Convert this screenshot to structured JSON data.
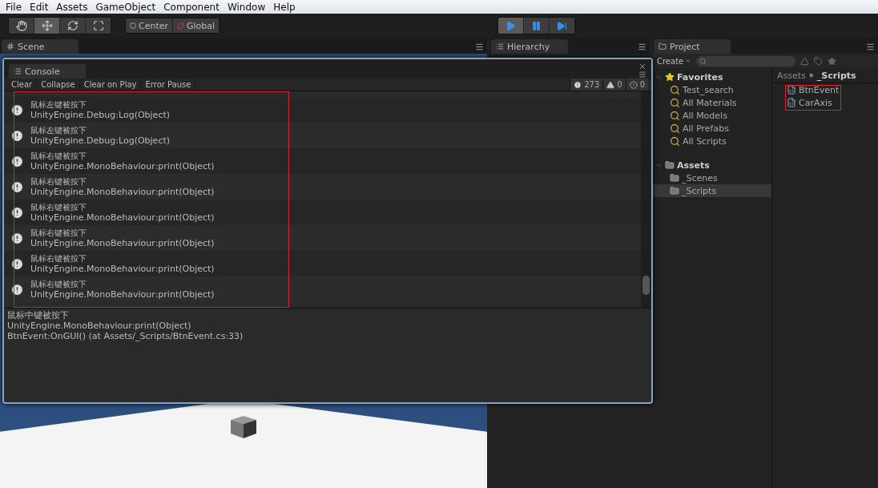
{
  "menu": [
    "File",
    "Edit",
    "Assets",
    "GameObject",
    "Component",
    "Window",
    "Help"
  ],
  "tools": [
    {
      "kind": "hand",
      "selected": false
    },
    {
      "kind": "move",
      "selected": true
    },
    {
      "kind": "rotate",
      "selected": false
    },
    {
      "kind": "scale",
      "selected": false
    }
  ],
  "pivot": [
    {
      "kind": "pivot",
      "label": "Center"
    },
    {
      "kind": "space",
      "label": "Global"
    }
  ],
  "playback": [
    {
      "kind": "play",
      "on": true
    },
    {
      "kind": "pause",
      "on": false
    },
    {
      "kind": "step",
      "on": false
    }
  ],
  "scene": {
    "tab": "Scene"
  },
  "hierarchy": {
    "tab": "Hierarchy"
  },
  "console": {
    "tab": "Console",
    "toolbar": [
      "Clear",
      "Collapse",
      "Clear on Play",
      "Error Pause"
    ],
    "counts": [
      {
        "kind": "log",
        "value": "273"
      },
      {
        "kind": "warning",
        "value": "0"
      },
      {
        "kind": "error",
        "value": "0"
      }
    ],
    "highlighted": true,
    "entries": [
      {
        "message": "鼠标左键被按下",
        "trace": "UnityEngine.Debug:Log(Object)"
      },
      {
        "message": "鼠标左键被按下",
        "trace": "UnityEngine.Debug:Log(Object)"
      },
      {
        "message": "鼠标右键被按下",
        "trace": "UnityEngine.MonoBehaviour:print(Object)"
      },
      {
        "message": "鼠标右键被按下",
        "trace": "UnityEngine.MonoBehaviour:print(Object)"
      },
      {
        "message": "鼠标右键被按下",
        "trace": "UnityEngine.MonoBehaviour:print(Object)"
      },
      {
        "message": "鼠标右键被按下",
        "trace": "UnityEngine.MonoBehaviour:print(Object)"
      },
      {
        "message": "鼠标右键被按下",
        "trace": "UnityEngine.MonoBehaviour:print(Object)"
      },
      {
        "message": "鼠标右键被按下",
        "trace": "UnityEngine.MonoBehaviour:print(Object)"
      }
    ],
    "details": [
      "鼠标中键被按下",
      "UnityEngine.MonoBehaviour:print(Object)",
      "BtnEvent:OnGUI() (at Assets/_Scripts/BtnEvent.cs:33)"
    ]
  },
  "project": {
    "tab": "Project",
    "create": "Create",
    "tree": [
      {
        "kind": "favorites",
        "label": "Favorites",
        "expanded": true,
        "selected": false,
        "children": [
          {
            "kind": "search",
            "label": "Test_search",
            "selected": false
          },
          {
            "kind": "search",
            "label": "All Materials",
            "selected": false
          },
          {
            "kind": "search",
            "label": "All Models",
            "selected": false
          },
          {
            "kind": "search",
            "label": "All Prefabs",
            "selected": false
          },
          {
            "kind": "search",
            "label": "All Scripts",
            "selected": false
          }
        ]
      },
      {
        "kind": "folder",
        "label": "Assets",
        "expanded": true,
        "selected": false,
        "children": [
          {
            "kind": "folder",
            "label": "_Scenes",
            "selected": false
          },
          {
            "kind": "folder",
            "label": "_Scripts",
            "selected": true
          }
        ]
      }
    ],
    "breadcrumb": [
      {
        "label": "Assets",
        "current": false
      },
      {
        "label": "_Scripts",
        "current": true
      }
    ],
    "highlighted": true,
    "files": [
      "BtnEvent",
      "CarAxis"
    ]
  }
}
